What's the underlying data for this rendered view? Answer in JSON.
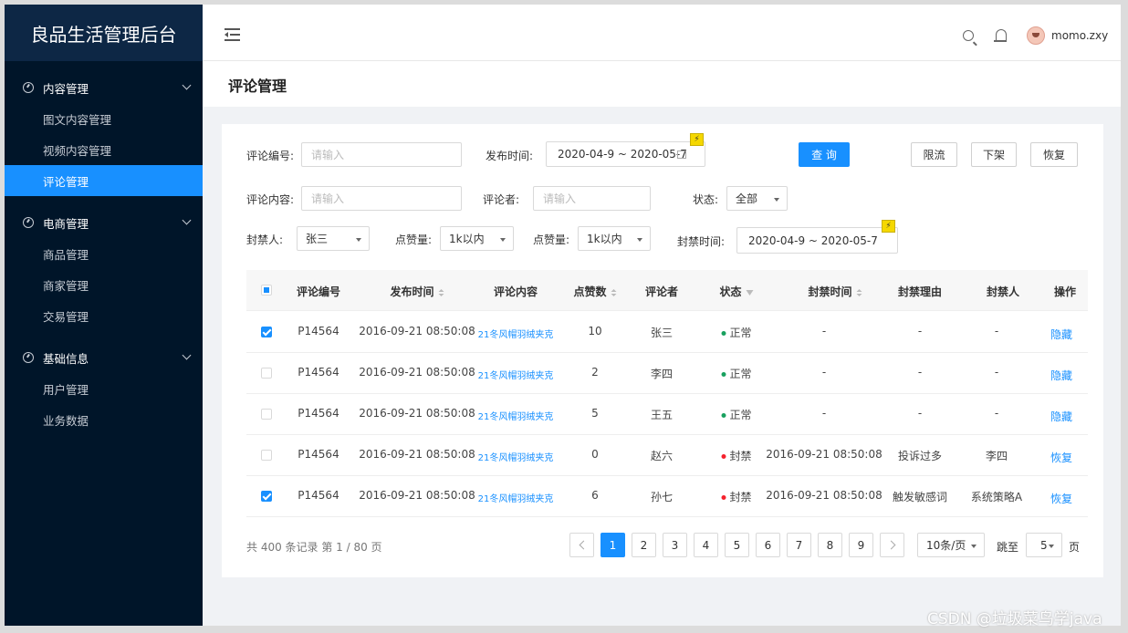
{
  "app_title": "良品生活管理后台",
  "sidebar": {
    "groups": [
      {
        "label": "内容管理",
        "items": [
          "图文内容管理",
          "视频内容管理",
          "评论管理"
        ]
      },
      {
        "label": "电商管理",
        "items": [
          "商品管理",
          "商家管理",
          "交易管理"
        ]
      },
      {
        "label": "基础信息",
        "items": [
          "用户管理",
          "业务数据"
        ]
      }
    ],
    "active_item": "评论管理"
  },
  "header": {
    "username": "momo.zxy"
  },
  "page_title": "评论管理",
  "filters": {
    "comment_id_label": "评论编号:",
    "comment_id_placeholder": "请输入",
    "publish_time_label": "发布时间:",
    "publish_time_value": "2020-04-9 ~ 2020-05-7",
    "query_button": "查 询",
    "limit_button": "限流",
    "offline_button": "下架",
    "restore_button": "恢复",
    "content_label": "评论内容:",
    "content_placeholder": "请输入",
    "commenter_label": "评论者:",
    "commenter_placeholder": "请输入",
    "status_label": "状态:",
    "status_value": "全部",
    "banner_label": "封禁人:",
    "banner_value": "张三",
    "likes1_label": "点赞量:",
    "likes1_value": "1k以内",
    "likes2_label": "点赞量:",
    "likes2_value": "1k以内",
    "ban_time_label": "封禁时间:",
    "ban_time_value": "2020-04-9 ~ 2020-05-7",
    "bolt_glyph": "⚡"
  },
  "table": {
    "columns": [
      "评论编号",
      "发布时间",
      "评论内容",
      "点赞数",
      "评论者",
      "状态",
      "封禁时间",
      "封禁理由",
      "封禁人",
      "操作"
    ],
    "rows": [
      {
        "id": "P14564",
        "time": "2016-09-21  08:50:08",
        "content": "21冬风帽羽绒夹克",
        "likes": "10",
        "user": "张三",
        "status": "正常",
        "ban_time": "-",
        "reason": "-",
        "banner": "-",
        "op": "隐藏",
        "checked": true
      },
      {
        "id": "P14564",
        "time": "2016-09-21  08:50:08",
        "content": "21冬风帽羽绒夹克",
        "likes": "2",
        "user": "李四",
        "status": "正常",
        "ban_time": "-",
        "reason": "-",
        "banner": "-",
        "op": "隐藏",
        "checked": false
      },
      {
        "id": "P14564",
        "time": "2016-09-21  08:50:08",
        "content": "21冬风帽羽绒夹克",
        "likes": "5",
        "user": "王五",
        "status": "正常",
        "ban_time": "-",
        "reason": "-",
        "banner": "-",
        "op": "隐藏",
        "checked": false
      },
      {
        "id": "P14564",
        "time": "2016-09-21  08:50:08",
        "content": "21冬风帽羽绒夹克",
        "likes": "0",
        "user": "赵六",
        "status": "封禁",
        "ban_time": "2016-09-21  08:50:08",
        "reason": "投诉过多",
        "banner": "李四",
        "op": "恢复",
        "checked": false
      },
      {
        "id": "P14564",
        "time": "2016-09-21  08:50:08",
        "content": "21冬风帽羽绒夹克",
        "likes": "6",
        "user": "孙七",
        "status": "封禁",
        "ban_time": "2016-09-21  08:50:08",
        "reason": "触发敏感词",
        "banner": "系统策略A",
        "op": "恢复",
        "checked": true
      }
    ]
  },
  "pagination": {
    "summary": "共 400 条记录 第 1 / 80 页",
    "pages": [
      "1",
      "2",
      "3",
      "4",
      "5",
      "6",
      "7",
      "8",
      "9"
    ],
    "current": "1",
    "page_size": "10条/页",
    "jump_label": "跳至",
    "jump_value": "5",
    "page_unit": "页"
  },
  "colors": {
    "primary": "#1890ff",
    "sidebar_bg": "#001529",
    "status_normal": "#19a15f",
    "status_banned": "#f5222d"
  },
  "watermark": "CSDN @垃圾菜鸟学java"
}
